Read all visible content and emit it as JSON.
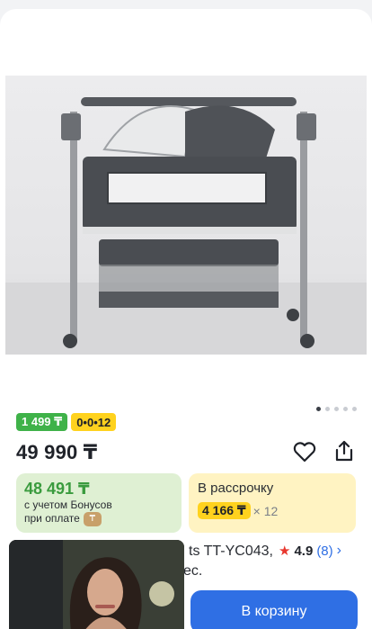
{
  "badges": {
    "price_badge": "1 499 ₸",
    "installment_badge": "0•0•12"
  },
  "product": {
    "price": "49 990 ₸",
    "title_fragment_1": "ts TT-YC043,",
    "title_fragment_2": "ес.",
    "rating": "4.9",
    "reviews": "(8)"
  },
  "bonus": {
    "amount": "48 491 ₸",
    "line1": "с учетом Бонусов",
    "line2": "при оплате",
    "coin_symbol": "₸"
  },
  "installment": {
    "label": "В рассрочку",
    "monthly": "4 166 ₸",
    "multiplier": "× 12"
  },
  "cart": {
    "label": "В корзину"
  },
  "carousel": {
    "total": 5,
    "active_index": 0
  },
  "colors": {
    "accent": "#2f6fe4",
    "green": "#3fb249",
    "yellow": "#ffd21e",
    "star": "#e8372e"
  },
  "icons": [
    "heart-icon",
    "share-icon",
    "star-icon",
    "chevron-right-icon",
    "bonus-coin-icon"
  ]
}
